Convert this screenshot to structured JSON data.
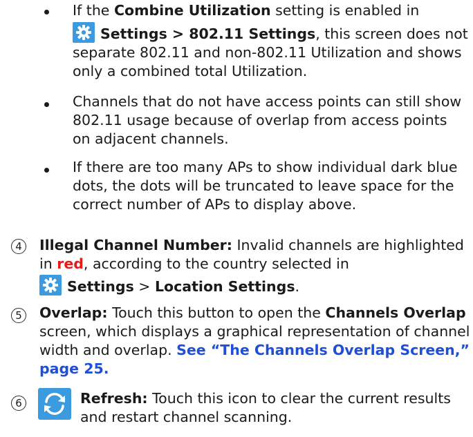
{
  "bullets": [
    {
      "pre": "If the ",
      "b1": "Combine Utilization",
      "mid": " setting is enabled in",
      "b2": "Settings > 802.11 Settings",
      "post": ", this screen does not separate 802.11 and non-802.11 Utilization and shows only a combined total Utilization."
    },
    {
      "text": "Channels that do not have access points can still show 802.11 usage because of overlap from access points on adjacent channels."
    },
    {
      "text": "If there are too many APs to show individual dark blue dots, the dots will be truncated to leave space for the correct number of APs to display above."
    }
  ],
  "items": [
    {
      "num": "4",
      "title": "Illegal Channel Number:",
      "t1": " Invalid channels are highlighted in ",
      "red": "red",
      "t2": ", according to the country selected in",
      "s1": "Settings",
      "sep": " > ",
      "s2": "Location Settings",
      "end": "."
    },
    {
      "num": "5",
      "title": "Overlap:",
      "t1": " Touch this button to open the ",
      "b1": "Channels Overlap",
      "t2": " screen, which displays a graphical representation of channel width and overlap. ",
      "link": "See “The Channels Overlap Screen,” page 25."
    },
    {
      "num": "6",
      "title": "Refresh:",
      "t1": " Touch this icon to clear the current results and restart channel scanning."
    }
  ],
  "colors": {
    "accent_blue": "#3c9bde",
    "red": "#e21b1b",
    "link": "#1f4fd8"
  },
  "icons": [
    "gear-icon",
    "refresh-icon"
  ]
}
